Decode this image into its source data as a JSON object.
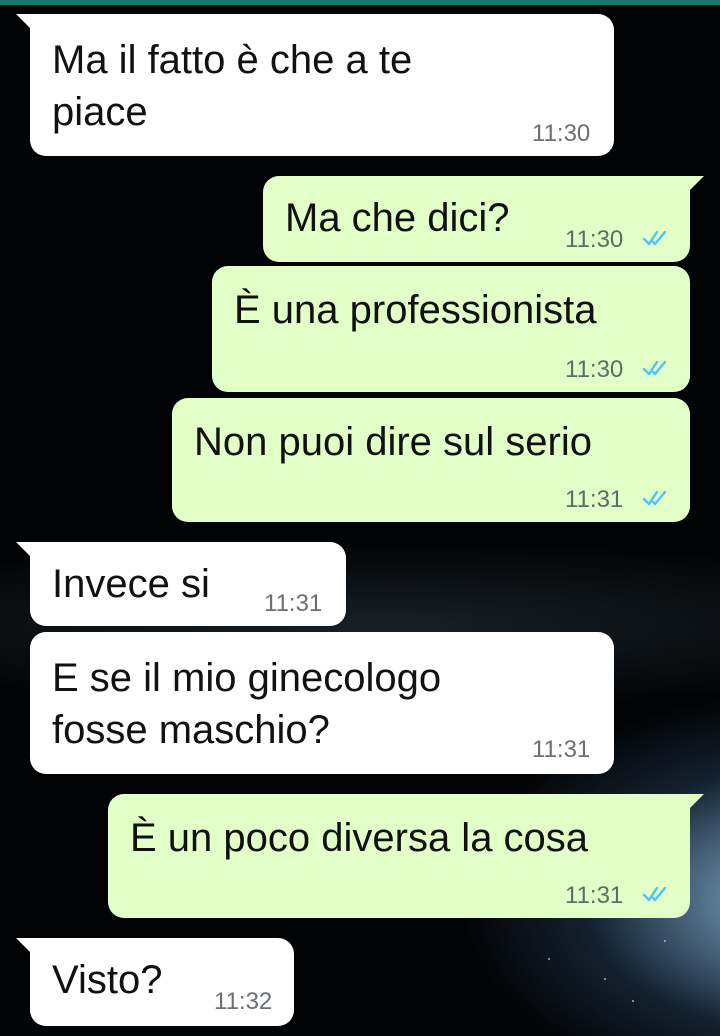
{
  "colors": {
    "incoming_bubble": "#ffffff",
    "outgoing_bubble": "#e1ffc7",
    "read_ticks": "#4fc3f7",
    "top_bar": "#14786a"
  },
  "messages": [
    {
      "direction": "incoming",
      "lines": [
        "Ma il fatto è che a te",
        "piace"
      ],
      "time": "11:30"
    },
    {
      "direction": "outgoing",
      "lines": [
        "Ma che dici?"
      ],
      "time": "11:30",
      "status": "read-double-check-icon"
    },
    {
      "direction": "outgoing",
      "lines": [
        "È una professionista"
      ],
      "time": "11:30",
      "status": "read-double-check-icon"
    },
    {
      "direction": "outgoing",
      "lines": [
        "Non puoi dire sul serio"
      ],
      "time": "11:31",
      "status": "read-double-check-icon"
    },
    {
      "direction": "incoming",
      "lines": [
        "Invece si"
      ],
      "time": "11:31"
    },
    {
      "direction": "incoming",
      "lines": [
        "E se il mio ginecologo",
        "fosse maschio?"
      ],
      "time": "11:31"
    },
    {
      "direction": "outgoing",
      "lines": [
        "È un poco diversa la cosa"
      ],
      "time": "11:31",
      "status": "read-double-check-icon"
    },
    {
      "direction": "incoming",
      "lines": [
        "Visto?"
      ],
      "time": "11:32"
    }
  ]
}
